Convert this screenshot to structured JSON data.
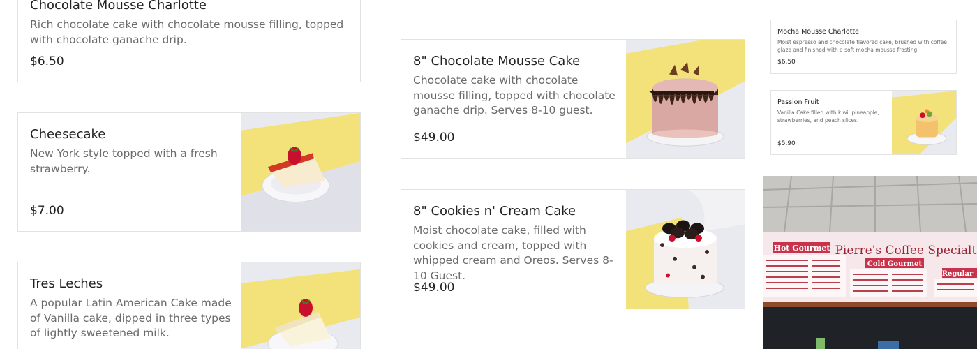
{
  "menu": {
    "items": [
      {
        "name": "Chocolate Mousse Charlotte",
        "description": "Rich chocolate cake with chocolate mousse filling, topped with chocolate ganache drip.",
        "price": "$6.50"
      },
      {
        "name": "Cheesecake",
        "description": "New York style topped with a fresh strawberry.",
        "price": "$7.00",
        "photo_icon": "cheesecake-slice"
      },
      {
        "name": "Tres Leches",
        "description": "A popular Latin American Cake made of Vanilla cake, dipped in three types of lightly sweetened milk.",
        "price": "",
        "photo_icon": "tres-leches-slice"
      },
      {
        "name": "8\" Chocolate Mousse Cake",
        "description": "Chocolate cake with chocolate mousse filling, topped with chocolate ganache drip. Serves 8-10 guest.",
        "price": "$49.00",
        "photo_icon": "chocolate-mousse-cake"
      },
      {
        "name": "8\" Cookies n' Cream Cake",
        "description": "Moist chocolate cake, filled with cookies and cream, topped with whipped cream and Oreos. Serves 8-10 Guest.",
        "price": "$49.00",
        "photo_icon": "cookies-cream-cake"
      },
      {
        "name": "Mocha Mousse Charlotte",
        "description": "Moist espresso and chocolate flavored cake, brushed with coffee glaze and finished with a soft mocha mousse frosting.",
        "price": "$6.50"
      },
      {
        "name": "Passion Fruit",
        "description": "Vanilla Cake filled with kiwi, pineapple, strawberries, and peach slices.",
        "price": "$5.90",
        "photo_icon": "passion-fruit-cake"
      }
    ]
  },
  "storefront": {
    "photo_icon": "coffee-shop-menu-board",
    "sign_main": "Pierre's Coffee Specialties",
    "sign_hot": "Hot Gourmet",
    "sign_cold": "Cold Gourmet",
    "sign_regular": "Regular"
  },
  "colors": {
    "card_border": "#e2e2e2",
    "text_primary": "#222222",
    "text_secondary": "#6b6b6b",
    "table_runner_yellow": "#f3e27a",
    "sign_red": "#c8324a",
    "sign_pink": "#f7dce0"
  }
}
